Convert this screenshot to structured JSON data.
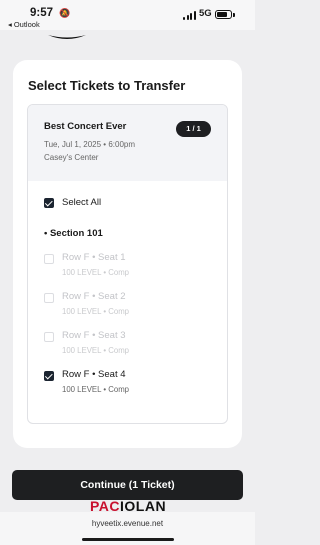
{
  "status_bar": {
    "time": "9:57",
    "back_app": "◂ Outlook",
    "network": "5G"
  },
  "sheet": {
    "title": "Select Tickets to Transfer",
    "event": {
      "name": "Best Concert Ever",
      "date": "Tue, Jul 1, 2025 • 6:00pm",
      "venue": "Casey's Center",
      "count_badge": "1 / 1"
    },
    "select_all": {
      "label": "Select All",
      "checked": true
    },
    "section_label": "• Section 101",
    "seats": [
      {
        "name": "Row F • Seat 1",
        "sub": "100 LEVEL • Comp",
        "checked": false,
        "enabled": false
      },
      {
        "name": "Row F • Seat 2",
        "sub": "100 LEVEL • Comp",
        "checked": false,
        "enabled": false
      },
      {
        "name": "Row F • Seat 3",
        "sub": "100 LEVEL • Comp",
        "checked": false,
        "enabled": false
      },
      {
        "name": "Row F • Seat 4",
        "sub": "100 LEVEL • Comp",
        "checked": true,
        "enabled": true
      }
    ]
  },
  "continue_button": {
    "label": "Continue (1 Ticket)"
  },
  "brand": {
    "logo_text": "PACIOLAN"
  },
  "browser": {
    "url": "hyveetix.evenue.net"
  },
  "colors": {
    "accent_dark": "#1e1f21",
    "brand_red": "#c8102e",
    "disabled_text": "#c3c4c8"
  }
}
